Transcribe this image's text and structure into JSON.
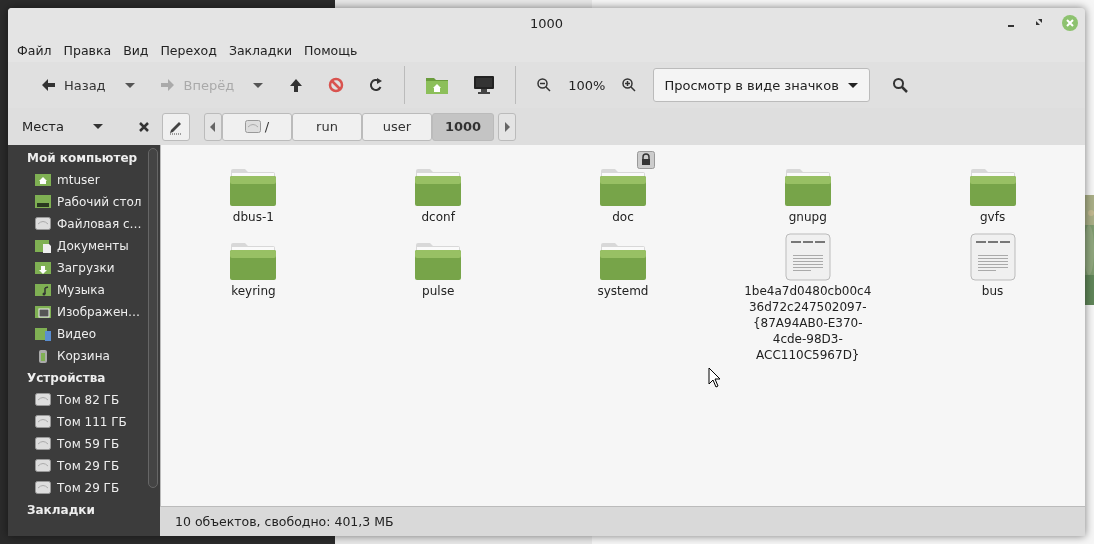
{
  "window": {
    "title": "1000"
  },
  "menu": [
    "Файл",
    "Правка",
    "Вид",
    "Переход",
    "Закладки",
    "Помощь"
  ],
  "toolbar": [
    {
      "kind": "back",
      "label": "Назад",
      "disabled": false
    },
    {
      "kind": "forward",
      "label": "Вперёд",
      "disabled": true
    },
    {
      "kind": "up"
    },
    {
      "kind": "stop"
    },
    {
      "kind": "reload"
    },
    {
      "kind": "separator"
    },
    {
      "kind": "home"
    },
    {
      "kind": "computer"
    },
    {
      "kind": "separator"
    },
    {
      "kind": "zoom_out"
    },
    {
      "kind": "zoom_reading",
      "label": "100%"
    },
    {
      "kind": "zoom_in"
    },
    {
      "kind": "view_selector",
      "label": "Просмотр в виде значков"
    },
    {
      "kind": "search"
    }
  ],
  "sidebar": {
    "title": "Места",
    "sections": [
      {
        "title": "Мой компьютер",
        "items": [
          {
            "label": "mtuser",
            "kind": "home"
          },
          {
            "label": "Рабочий стол",
            "kind": "desktop"
          },
          {
            "label": "Файловая с…",
            "kind": "drive"
          },
          {
            "label": "Документы",
            "kind": "documents"
          },
          {
            "label": "Загрузки",
            "kind": "downloads"
          },
          {
            "label": "Музыка",
            "kind": "music"
          },
          {
            "label": "Изображен…",
            "kind": "pictures"
          },
          {
            "label": "Видео",
            "kind": "video"
          },
          {
            "label": "Корзина",
            "kind": "trash"
          }
        ]
      },
      {
        "title": "Устройства",
        "items": [
          {
            "label": "Том 82 ГБ",
            "kind": "drive"
          },
          {
            "label": "Том 111 ГБ",
            "kind": "drive"
          },
          {
            "label": "Том 59 ГБ",
            "kind": "drive"
          },
          {
            "label": "Том 29 ГБ",
            "kind": "drive"
          },
          {
            "label": "Том 29 ГБ",
            "kind": "drive"
          }
        ]
      },
      {
        "title": "Закладки"
      }
    ]
  },
  "path": [
    {
      "label": "/",
      "kind": "root",
      "selected": false
    },
    {
      "label": "run",
      "kind": "dir",
      "selected": false
    },
    {
      "label": "user",
      "kind": "dir",
      "selected": false
    },
    {
      "label": "1000",
      "kind": "dir",
      "selected": true
    }
  ],
  "files": [
    {
      "name": "dbus-1",
      "kind": "folder",
      "locked": false
    },
    {
      "name": "dconf",
      "kind": "folder",
      "locked": false
    },
    {
      "name": "doc",
      "kind": "folder",
      "locked": true
    },
    {
      "name": "gnupg",
      "kind": "folder",
      "locked": false
    },
    {
      "name": "gvfs",
      "kind": "folder",
      "locked": false
    },
    {
      "name": "keyring",
      "kind": "folder",
      "locked": false
    },
    {
      "name": "pulse",
      "kind": "folder",
      "locked": false
    },
    {
      "name": "systemd",
      "kind": "folder",
      "locked": false
    },
    {
      "name": "1be4a7d0480cb00c436d72c247502097-{87A94AB0-E370-4cde-98D3-ACC110C5967D}",
      "kind": "text",
      "locked": false
    },
    {
      "name": "bus",
      "kind": "text",
      "locked": false
    }
  ],
  "status_bar": "10 объектов, свободно: 401,3 МБ"
}
